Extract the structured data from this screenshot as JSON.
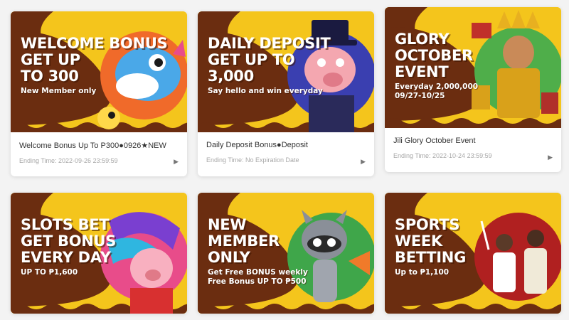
{
  "colors": {
    "banner_yellow": "#f4c51c",
    "banner_brown": "#6b2d10",
    "banner_text": "#ffffff",
    "card_bg": "#ffffff",
    "page_bg": "#f3f3f3"
  },
  "promotions": [
    {
      "headline": "WELCOME BONUS\nGET UP\nTO 300",
      "subline": "New Member only",
      "title": "Welcome Bonus Up To P300●0926★NEW",
      "ending_time": "Ending Time: 2022-09-26 23:59:59",
      "art_icon": "fish-mascot-icon"
    },
    {
      "headline": "DAILY DEPOSIT\nGET UP TO\n3,000",
      "subline": "Say hello and win everyday",
      "title": "Daily Deposit Bonus●Deposit",
      "ending_time": "Ending Time: No Expiration Date",
      "art_icon": "pig-gentleman-icon"
    },
    {
      "headline": "GLORY\nOCTOBER\nEVENT",
      "subline": "Everyday 2,000,000\n09/27-10/25",
      "title": "Jili Glory October Event",
      "ending_time": "Ending Time: 2022-10-24 23:59:59",
      "art_icon": "aztec-king-icon"
    },
    {
      "headline": "SLOTS BET\nGET BONUS\nEVERY DAY",
      "subline": "UP TO ₱1,600",
      "title": "",
      "ending_time": "",
      "art_icon": "fortune-pig-icon"
    },
    {
      "headline": "NEW\nMEMBER\nONLY",
      "subline": "Get Free BONUS weekly\nFree Bonus UP TO ₱500",
      "title": "",
      "ending_time": "",
      "art_icon": "raccoon-mascot-icon"
    },
    {
      "headline": "SPORTS\nWEEK\nBETTING",
      "subline": "Up to ₱1,100",
      "title": "",
      "ending_time": "",
      "art_icon": "basketball-players-icon"
    }
  ]
}
